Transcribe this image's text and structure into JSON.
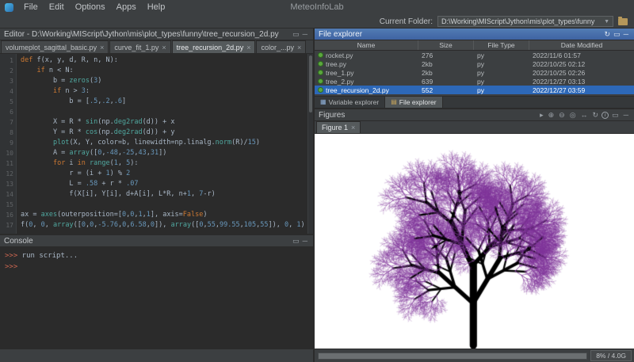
{
  "menubar": {
    "menus": [
      "File",
      "Edit",
      "Options",
      "Apps",
      "Help"
    ],
    "app_title": "MeteoInfoLab",
    "current_folder": {
      "label": "Current Folder:",
      "value": "D:\\Working\\MIScript\\Jython\\mis\\plot_types\\funny"
    }
  },
  "editor": {
    "title": "Editor - D:\\Working\\MIScript\\Jython\\mis\\plot_types\\funny\\tree_recursion_2d.py",
    "title_icons": [
      {
        "name": "float-panel-icon",
        "glyph": "▭"
      },
      {
        "name": "minimize-panel-icon",
        "glyph": "─"
      }
    ],
    "tabs": [
      {
        "label": "volumeplot_sagittal_basic.py",
        "active": false
      },
      {
        "label": "curve_fit_1.py",
        "active": false
      },
      {
        "label": "tree_recursion_2d.py",
        "active": true
      },
      {
        "label": "color_...py",
        "active": false
      }
    ],
    "code": [
      [
        [
          "kw",
          "def"
        ],
        [
          "pl",
          " f(x, y, d, R, n, N):"
        ]
      ],
      [
        [
          "pl",
          "    "
        ],
        [
          "kw",
          "if"
        ],
        [
          "pl",
          " n < N:"
        ]
      ],
      [
        [
          "pl",
          "        b = "
        ],
        [
          "fn",
          "zeros"
        ],
        [
          "pl",
          "("
        ],
        [
          "num",
          "3"
        ],
        [
          "pl",
          ")"
        ]
      ],
      [
        [
          "pl",
          "        "
        ],
        [
          "kw",
          "if"
        ],
        [
          "pl",
          " n > "
        ],
        [
          "num",
          "3"
        ],
        [
          "pl",
          ":"
        ]
      ],
      [
        [
          "pl",
          "            b = ["
        ],
        [
          "num",
          ".5"
        ],
        [
          "pl",
          ","
        ],
        [
          "num",
          ".2"
        ],
        [
          "pl",
          ","
        ],
        [
          "num",
          ".6"
        ],
        [
          "pl",
          "]"
        ]
      ],
      [],
      [
        [
          "pl",
          "        X = R * "
        ],
        [
          "fn",
          "sin"
        ],
        [
          "pl",
          "(np."
        ],
        [
          "fn",
          "deg2rad"
        ],
        [
          "pl",
          "(d)) + x"
        ]
      ],
      [
        [
          "pl",
          "        Y = R * "
        ],
        [
          "fn",
          "cos"
        ],
        [
          "pl",
          "(np."
        ],
        [
          "fn",
          "deg2rad"
        ],
        [
          "pl",
          "(d)) + y"
        ]
      ],
      [
        [
          "pl",
          "        "
        ],
        [
          "fn",
          "plot"
        ],
        [
          "pl",
          "(X, Y, color=b, linewidth=np.linalg."
        ],
        [
          "fn",
          "norm"
        ],
        [
          "pl",
          "(R)/"
        ],
        [
          "num",
          "15"
        ],
        [
          "pl",
          ")"
        ]
      ],
      [
        [
          "pl",
          "        A = "
        ],
        [
          "fn",
          "array"
        ],
        [
          "pl",
          "(["
        ],
        [
          "num",
          "0"
        ],
        [
          "pl",
          ","
        ],
        [
          "num",
          "-48"
        ],
        [
          "pl",
          ","
        ],
        [
          "num",
          "-25"
        ],
        [
          "pl",
          ","
        ],
        [
          "num",
          "43"
        ],
        [
          "pl",
          ","
        ],
        [
          "num",
          "31"
        ],
        [
          "pl",
          "])"
        ]
      ],
      [
        [
          "pl",
          "        "
        ],
        [
          "kw",
          "for"
        ],
        [
          "pl",
          " i "
        ],
        [
          "kw",
          "in"
        ],
        [
          "pl",
          " "
        ],
        [
          "fn",
          "range"
        ],
        [
          "pl",
          "("
        ],
        [
          "num",
          "1"
        ],
        [
          "pl",
          ", "
        ],
        [
          "num",
          "5"
        ],
        [
          "pl",
          "):"
        ]
      ],
      [
        [
          "pl",
          "            r = (i + "
        ],
        [
          "num",
          "1"
        ],
        [
          "pl",
          ") % "
        ],
        [
          "num",
          "2"
        ]
      ],
      [
        [
          "pl",
          "            L = "
        ],
        [
          "num",
          ".58"
        ],
        [
          "pl",
          " + r * "
        ],
        [
          "num",
          ".07"
        ]
      ],
      [
        [
          "pl",
          "            f(X[i], Y[i], d+A[i], L*R, n+"
        ],
        [
          "num",
          "1"
        ],
        [
          "pl",
          ", "
        ],
        [
          "num",
          "7"
        ],
        [
          "pl",
          "-r)"
        ]
      ],
      [],
      [
        [
          "pl",
          "ax = "
        ],
        [
          "fn",
          "axes"
        ],
        [
          "pl",
          "(outerposition=["
        ],
        [
          "num",
          "0"
        ],
        [
          "pl",
          ","
        ],
        [
          "num",
          "0"
        ],
        [
          "pl",
          ","
        ],
        [
          "num",
          "1"
        ],
        [
          "pl",
          ","
        ],
        [
          "num",
          "1"
        ],
        [
          "pl",
          "], axis="
        ],
        [
          "kw",
          "False"
        ],
        [
          "pl",
          ")"
        ]
      ],
      [
        [
          "pl",
          "f("
        ],
        [
          "num",
          "0"
        ],
        [
          "pl",
          ", "
        ],
        [
          "num",
          "0"
        ],
        [
          "pl",
          ", "
        ],
        [
          "fn",
          "array"
        ],
        [
          "pl",
          "(["
        ],
        [
          "num",
          "0"
        ],
        [
          "pl",
          ","
        ],
        [
          "num",
          "0"
        ],
        [
          "pl",
          ","
        ],
        [
          "num",
          "-5.76"
        ],
        [
          "pl",
          ","
        ],
        [
          "num",
          "0"
        ],
        [
          "pl",
          ","
        ],
        [
          "num",
          "6.58"
        ],
        [
          "pl",
          ","
        ],
        [
          "num",
          "0"
        ],
        [
          "pl",
          "]), "
        ],
        [
          "fn",
          "array"
        ],
        [
          "pl",
          "(["
        ],
        [
          "num",
          "0"
        ],
        [
          "pl",
          ","
        ],
        [
          "num",
          "55"
        ],
        [
          "pl",
          ","
        ],
        [
          "num",
          "99.55"
        ],
        [
          "pl",
          ","
        ],
        [
          "num",
          "105"
        ],
        [
          "pl",
          ","
        ],
        [
          "num",
          "55"
        ],
        [
          "pl",
          "]), "
        ],
        [
          "num",
          "0"
        ],
        [
          "pl",
          ", "
        ],
        [
          "num",
          "1"
        ],
        [
          "pl",
          ")"
        ]
      ]
    ]
  },
  "console": {
    "title": "Console",
    "title_icons": [
      {
        "name": "float-panel-icon",
        "glyph": "▭"
      },
      {
        "name": "minimize-panel-icon",
        "glyph": "─"
      }
    ],
    "lines": [
      {
        "prompt": ">>>",
        "text": "run script..."
      },
      {
        "prompt": ">>>",
        "text": ""
      }
    ]
  },
  "file_explorer": {
    "title": "File explorer",
    "title_icons": [
      {
        "name": "refresh-icon",
        "glyph": "↻"
      },
      {
        "name": "float-panel-icon",
        "glyph": "▭"
      },
      {
        "name": "minimize-panel-icon",
        "glyph": "─"
      }
    ],
    "columns": [
      "Name",
      "Size",
      "File Type",
      "Date Modified"
    ],
    "rows": [
      {
        "name": "rocket.py",
        "size": "276",
        "type": "py",
        "modified": "2022/11/6 01:57",
        "selected": false
      },
      {
        "name": "tree.py",
        "size": "2kb",
        "type": "py",
        "modified": "2022/10/25 02:12",
        "selected": false
      },
      {
        "name": "tree_1.py",
        "size": "2kb",
        "type": "py",
        "modified": "2022/10/25 02:26",
        "selected": false
      },
      {
        "name": "tree_2.py",
        "size": "639",
        "type": "py",
        "modified": "2022/12/27 03:13",
        "selected": false
      },
      {
        "name": "tree_recursion_2d.py",
        "size": "552",
        "type": "py",
        "modified": "2022/12/27 03:59",
        "selected": true
      }
    ],
    "bottom_tabs": [
      {
        "label": "Variable explorer",
        "active": false,
        "icon_name": "variable-grid-icon",
        "icon_glyph": "▦",
        "icon_color": "#8fb0d8"
      },
      {
        "label": "File explorer",
        "active": true,
        "icon_name": "folder-icon",
        "icon_glyph": "▤",
        "icon_color": "#c9a55b"
      }
    ]
  },
  "figures": {
    "title": "Figures",
    "toolbar_icons": [
      {
        "name": "select-cursor-icon",
        "glyph": "▸"
      },
      {
        "name": "zoom-in-icon",
        "glyph": "⊕"
      },
      {
        "name": "zoom-out-icon",
        "glyph": "⊖"
      },
      {
        "name": "full-extent-icon",
        "glyph": "◎"
      },
      {
        "name": "pan-icon",
        "glyph": "↔"
      },
      {
        "name": "rotate-icon",
        "glyph": "↻"
      },
      {
        "name": "identify-icon",
        "glyph": "i"
      },
      {
        "name": "float-panel-icon",
        "glyph": "▭"
      },
      {
        "name": "minimize-panel-icon",
        "glyph": "─"
      }
    ],
    "tabs": [
      {
        "label": "Figure 1",
        "active": true
      }
    ],
    "tree": {
      "trunk_x_frac": 0.497,
      "base_margin": 4,
      "trunk_len_frac": 0.375,
      "offsets_deg": [
        -48,
        -25,
        43,
        31
      ],
      "length_factors": [
        0.58,
        0.65,
        0.58,
        0.65
      ],
      "attach_fractions": [
        0.52,
        0.95,
        1.0,
        0.53
      ],
      "max_depth": 7,
      "purple_after_depth": 3,
      "trunk_color": "#000000",
      "twig_color": "#7f3399"
    }
  },
  "statusbar": {
    "memory": "8% / 4.0G"
  }
}
